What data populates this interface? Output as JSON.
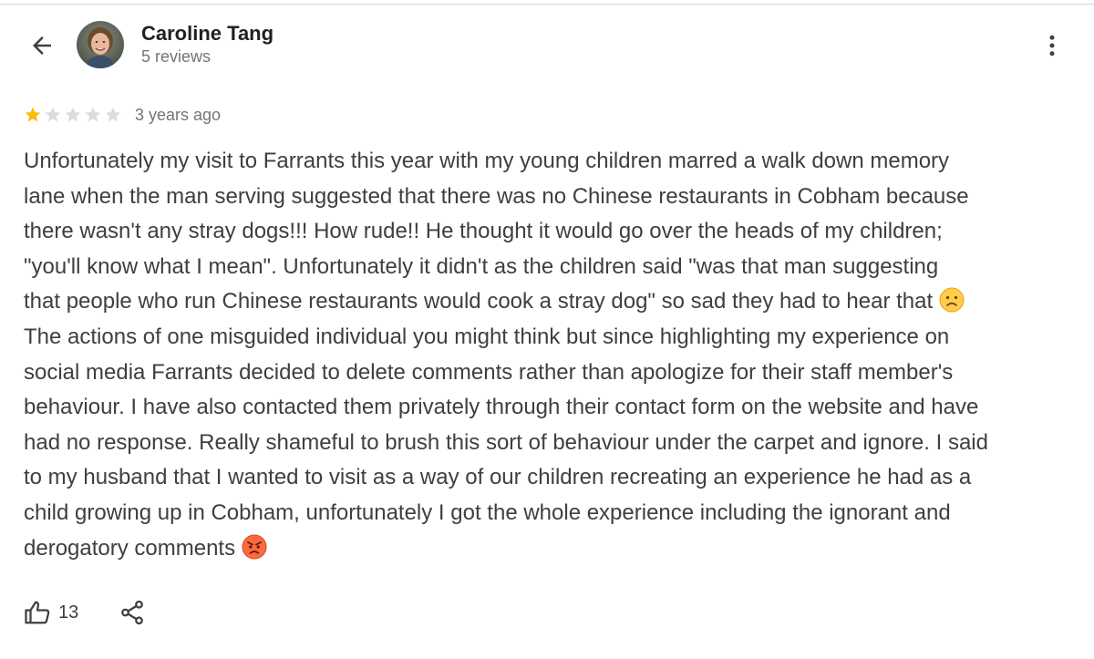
{
  "header": {
    "author_name": "Caroline Tang",
    "review_count": "5 reviews",
    "icons": {
      "back": "arrow-back-icon",
      "avatar": "profile-photo",
      "menu": "more-vert-icon"
    }
  },
  "review": {
    "rating": 1,
    "max_rating": 5,
    "date": "3 years ago",
    "text_part1": "Unfortunately my visit to Farrants this year with my young children marred a walk down memory\nlane when the man serving suggested that there was no Chinese restaurants in Cobham because\nthere wasn't any stray dogs!!! How rude!! He thought it would go over the heads of my children;\n\"you'll know what I mean\". Unfortunately it didn't as the children said \"was that man suggesting\nthat people who run Chinese restaurants would cook a stray dog\" so sad they had to hear that",
    "text_part2": "\nThe actions of one misguided individual you might think but since highlighting my experience on\nsocial media Farrants decided to delete comments rather than apologize for their staff member's\nbehaviour. I have also contacted them privately through their contact form on the website and have\nhad no response. Really shameful to brush this sort of behaviour under the carpet and ignore. I said\nto my husband that I wanted to visit as a way of our children recreating an experience he had as a\nchild growing up in Cobham, unfortunately I got the whole experience including the ignorant and\nderogatory comments",
    "emojis": [
      "sad-face-emoji",
      "angry-face-emoji"
    ]
  },
  "actions": {
    "like_count": "13",
    "icons": {
      "like": "thumbs-up-icon",
      "share": "share-icon"
    }
  },
  "colors": {
    "star_filled": "#fbbc04",
    "star_empty": "#dadce0",
    "secondary_text": "#70757a",
    "body_text": "#3c4043"
  }
}
